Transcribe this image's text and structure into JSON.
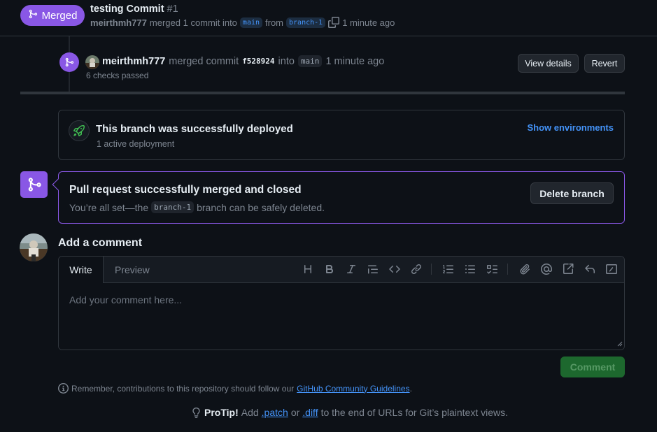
{
  "header": {
    "badge_label": "Merged",
    "title": "testing Commit",
    "number": "#1",
    "author": "meirthmh777",
    "merged_text": "merged 1 commit into",
    "base_branch": "main",
    "from_text": "from",
    "head_branch": "branch-1",
    "time": "1 minute ago"
  },
  "event": {
    "user": "meirthmh777",
    "action": "merged commit",
    "sha": "f528924",
    "into": "into",
    "branch": "main",
    "time": "1 minute ago",
    "checks": "6 checks passed",
    "view_details": "View details",
    "revert": "Revert"
  },
  "deploy": {
    "title": "This branch was successfully deployed",
    "subtitle": "1 active deployment",
    "show_envs": "Show environments"
  },
  "merged_box": {
    "title": "Pull request successfully merged and closed",
    "sub_prefix": "You’re all set—the",
    "branch": "branch-1",
    "sub_suffix": "branch can be safely deleted.",
    "delete_button": "Delete branch"
  },
  "comment": {
    "heading": "Add a comment",
    "tab_write": "Write",
    "tab_preview": "Preview",
    "placeholder": "Add your comment here...",
    "submit": "Comment",
    "toolbar_icons": [
      "heading-icon",
      "bold-icon",
      "italic-icon",
      "quote-icon",
      "code-icon",
      "link-icon",
      "ordered-list-icon",
      "unordered-list-icon",
      "task-list-icon",
      "attach-icon",
      "mention-icon",
      "reference-icon",
      "reply-icon",
      "slash-command-icon"
    ]
  },
  "footer": {
    "guidelines_prefix": "Remember, contributions to this repository should follow our",
    "guidelines_link": "GitHub Community Guidelines",
    "guidelines_suffix": ".",
    "protip_label": "ProTip!",
    "protip_add": "Add",
    "patch_link": ".patch",
    "or_text": "or",
    "diff_link": ".diff",
    "protip_suffix": "to the end of URLs for Git’s plaintext views."
  },
  "colors": {
    "background": "#0d1117",
    "merged_purple": "#8957e5",
    "link_blue": "#4493f8",
    "success_green": "#238636",
    "muted_text": "#7d8590"
  }
}
